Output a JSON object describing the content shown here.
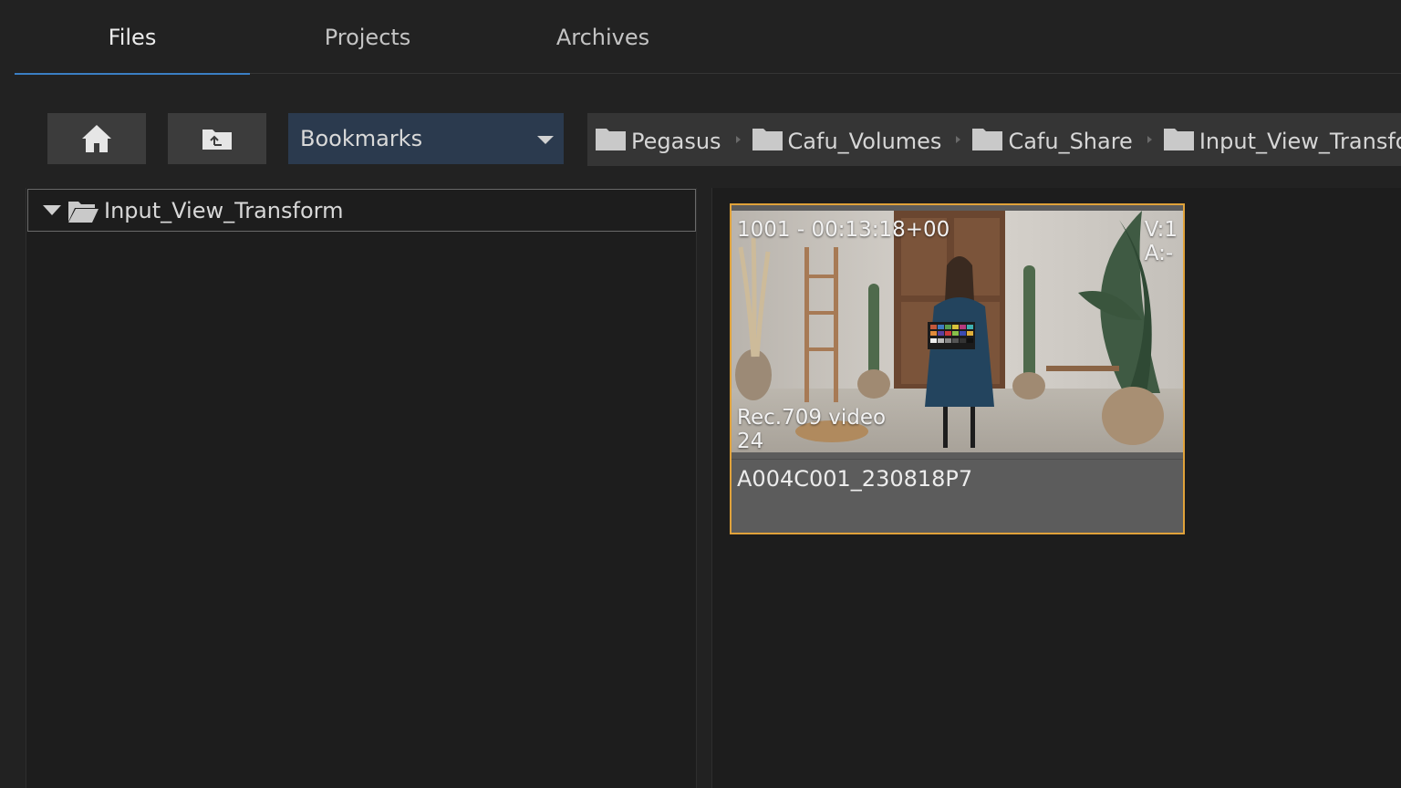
{
  "tabs": [
    {
      "label": "Files",
      "active": true
    },
    {
      "label": "Projects",
      "active": false
    },
    {
      "label": "Archives",
      "active": false
    }
  ],
  "toolbar": {
    "home_icon": "home-icon",
    "up_icon": "folder-up-icon",
    "bookmarks_label": "Bookmarks"
  },
  "breadcrumb": [
    {
      "label": "Pegasus"
    },
    {
      "label": "Cafu_Volumes"
    },
    {
      "label": "Cafu_Share"
    },
    {
      "label": "Input_View_Transform"
    }
  ],
  "tree": {
    "root_label": "Input_View_Transform",
    "expanded": true
  },
  "clip": {
    "timecode": "1001 - 00:13:18+00",
    "video_tracks": "V:1",
    "audio_tracks": "A:-",
    "colorspace": "Rec.709 video",
    "fps": "24",
    "name": "A004C001_230818P7"
  },
  "colors": {
    "accent_tab": "#3a7fc4",
    "selection_border": "#e0a23a",
    "bookmarks_bg": "#2b3a4e"
  }
}
